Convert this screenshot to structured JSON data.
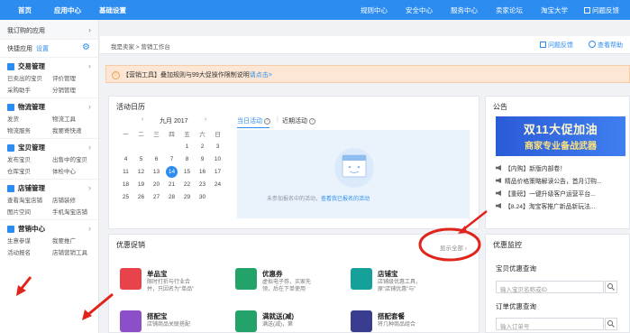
{
  "topnav": {
    "left": [
      {
        "label": "首页",
        "bold": true
      },
      {
        "label": "应用中心",
        "bold": true
      },
      {
        "label": "基础设置",
        "bold": true
      }
    ],
    "right": [
      "规则中心",
      "安全中心",
      "服务中心",
      "卖家论坛",
      "淘宝大学",
      "问题反馈"
    ]
  },
  "sidebar": {
    "head": "我订购的应用",
    "quick_label": "快捷应用",
    "quick_setting": "设置",
    "sections": [
      {
        "title": "交易管理",
        "color": "#2d8cf0",
        "links": [
          "已卖出的宝贝",
          "评价管理",
          "采购助手",
          "分销管理"
        ]
      },
      {
        "title": "物流管理",
        "color": "#2d8cf0",
        "links": [
          "发货",
          "物流工具",
          "物流服务",
          "我要寄快递"
        ]
      },
      {
        "title": "宝贝管理",
        "color": "#2d8cf0",
        "links": [
          "发布宝贝",
          "出售中的宝贝",
          "仓库宝贝",
          "体检中心"
        ]
      },
      {
        "title": "店铺管理",
        "color": "#2d8cf0",
        "links": [
          "查看淘宝店铺",
          "店铺装修",
          "图片空间",
          "手机淘宝店铺"
        ]
      },
      {
        "title": "营销中心",
        "color": "#2d8cf0",
        "links": [
          "生意参谋",
          "我要推广",
          "活动报名",
          "店铺营销工具"
        ]
      }
    ]
  },
  "crumbs": "我是卖家  >  营销工作台",
  "crumb_actions": {
    "feedback": "问题反馈",
    "help": "查看帮助"
  },
  "notice": {
    "prefix": "【营销工具】叠加规则与99大促操作限制说明",
    "link": "请点击>"
  },
  "calendar_panel": {
    "title": "活动日历",
    "month_label": "九月  2017",
    "weekdays": [
      "一",
      "二",
      "三",
      "四",
      "五",
      "六",
      "日"
    ],
    "rows": [
      [
        "",
        "",
        "",
        "",
        "1",
        "2",
        "3"
      ],
      [
        "4",
        "5",
        "6",
        "7",
        "8",
        "9",
        "10"
      ],
      [
        "11",
        "12",
        "13",
        "14",
        "15",
        "16",
        "17"
      ],
      [
        "18",
        "19",
        "20",
        "21",
        "22",
        "23",
        "24"
      ],
      [
        "25",
        "26",
        "27",
        "28",
        "29",
        "30",
        ""
      ]
    ],
    "today": "14",
    "tab_current": "当日活动",
    "tab_recent": "近期活动",
    "empty_text": "未参加报名中的活动",
    "empty_link": "查看我已报名的活动"
  },
  "announcement": {
    "title": "公告",
    "banner_line1": "双11大促加油",
    "banner_line2": "商家专业备战武器",
    "items": [
      "【内购】新版内部卷！",
      "精品价格策略解读公告，首月订购...",
      "【重磅】一键升级客户运营平台...",
      "【8.24】淘宝客推广新品新玩法..."
    ]
  },
  "discount_panel": {
    "title": "优惠促销",
    "show_all": "显示全部",
    "items": [
      {
        "name": "单品宝",
        "desc": "限时打折与行业合并，只因名为\"单品\"",
        "color": "#e8434b",
        "icon": "single-item-icon"
      },
      {
        "name": "优惠券",
        "desc": "虚拟电子券，买家先领，后在下单使用",
        "color": "#23a36a",
        "icon": "coupon-icon"
      },
      {
        "name": "店铺宝",
        "desc": "店铺级优惠工具，原\"店铺优惠\"与\"",
        "color": "#15a09a",
        "icon": "store-icon"
      },
      {
        "name": "搭配宝",
        "desc": "店铺商品关联搭配",
        "color": "#8b4fc9",
        "icon": "bundle-icon"
      },
      {
        "name": "满就送(减)",
        "desc": "满送(减)，第",
        "color": "#23a36a",
        "icon": "full-reduce-icon"
      },
      {
        "name": "搭配套餐",
        "desc": "将几种商品组合",
        "color": "#3a3d8f",
        "icon": "package-icon"
      }
    ]
  },
  "monitor_panel": {
    "title": "优惠监控",
    "label1": "宝贝优惠查询",
    "placeholder1": "输入宝贝名称或ID",
    "label2": "订单优惠查询",
    "placeholder2": "输入订单号"
  }
}
